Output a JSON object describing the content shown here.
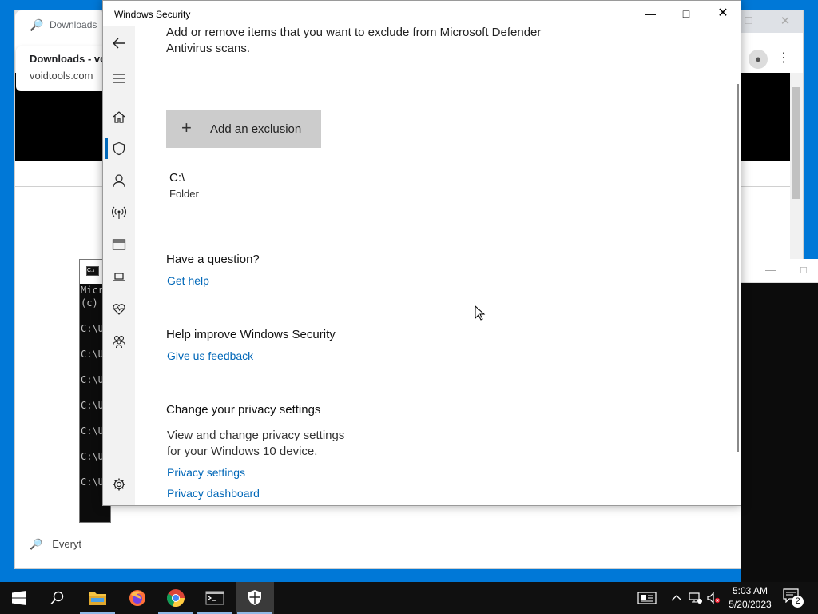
{
  "background_browser": {
    "tab_label": "Downloads",
    "popup_title": "Downloads - vo",
    "popup_subtitle": "voidtools.com",
    "search_text": "Everyt"
  },
  "cmd_window": {
    "lines": [
      "Micr",
      "(c)",
      "C:\\U",
      "C:\\U",
      "C:\\U",
      "C:\\U",
      "C:\\U",
      "C:\\U",
      "C:\\U"
    ]
  },
  "windows_security": {
    "title": "Windows Security",
    "description_line1": "Add or remove items that you want to exclude from Microsoft Defender",
    "description_line2": "Antivirus scans.",
    "add_exclusion_label": "Add an exclusion",
    "exclusion": {
      "path": "C:\\",
      "type": "Folder"
    },
    "question_heading": "Have a question?",
    "get_help_link": "Get help",
    "improve_heading": "Help improve Windows Security",
    "feedback_link": "Give us feedback",
    "privacy_heading": "Change your privacy settings",
    "privacy_para_line1": "View and change privacy settings",
    "privacy_para_line2": "for your Windows 10 device.",
    "privacy_settings_link": "Privacy settings",
    "privacy_dashboard_link": "Privacy dashboard",
    "nav_icons": [
      "back-icon",
      "hamburger-icon",
      "home-icon",
      "shield-icon",
      "person-icon",
      "wireless-icon",
      "app-browser-icon",
      "laptop-icon",
      "heart-pulse-icon",
      "family-icon",
      "gear-icon"
    ]
  },
  "taskbar": {
    "time": "5:03 AM",
    "date": "5/20/2023",
    "notification_count": "2",
    "pinned": [
      "start",
      "search",
      "file-explorer",
      "firefox",
      "chrome",
      "command-prompt",
      "windows-security"
    ]
  },
  "colors": {
    "link": "#0067b8",
    "taskbar": "#101010",
    "desktop": "#0078d7"
  }
}
